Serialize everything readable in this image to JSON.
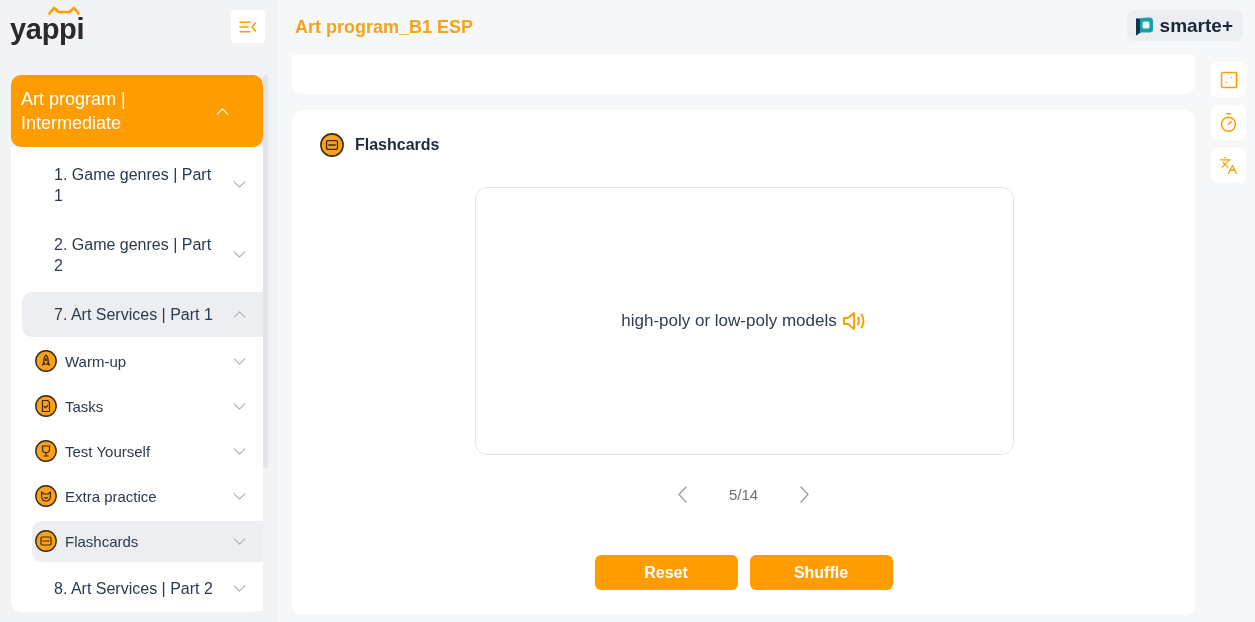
{
  "sidebar": {
    "logo": "yappi",
    "course": {
      "title": "Art program | Intermediate",
      "expanded": true,
      "children": [
        {
          "label": "1. Game genres | Part 1",
          "expanded": false
        },
        {
          "label": "2. Game genres | Part 2",
          "expanded": false
        },
        {
          "label": "7. Art Services | Part 1",
          "expanded": true,
          "children": [
            {
              "label": "Warm-up",
              "kind": "warmup",
              "expanded": false,
              "selected": false
            },
            {
              "label": "Tasks",
              "kind": "tasks",
              "expanded": false,
              "selected": false
            },
            {
              "label": "Test Yourself",
              "kind": "test",
              "expanded": false,
              "selected": false
            },
            {
              "label": "Extra practice",
              "kind": "extra",
              "expanded": false,
              "selected": false
            },
            {
              "label": "Flashcards",
              "kind": "flashcards",
              "expanded": false,
              "selected": true
            }
          ]
        },
        {
          "label": "8. Art Services | Part 2",
          "expanded": false
        }
      ]
    }
  },
  "header": {
    "title": "Art program_B1 ESP",
    "brand": "smarte+"
  },
  "flashcards": {
    "title": "Flashcards",
    "card_text": "high-poly or low-poly models",
    "counter": "5/14",
    "buttons": [
      "Reset",
      "Shuffle"
    ]
  }
}
